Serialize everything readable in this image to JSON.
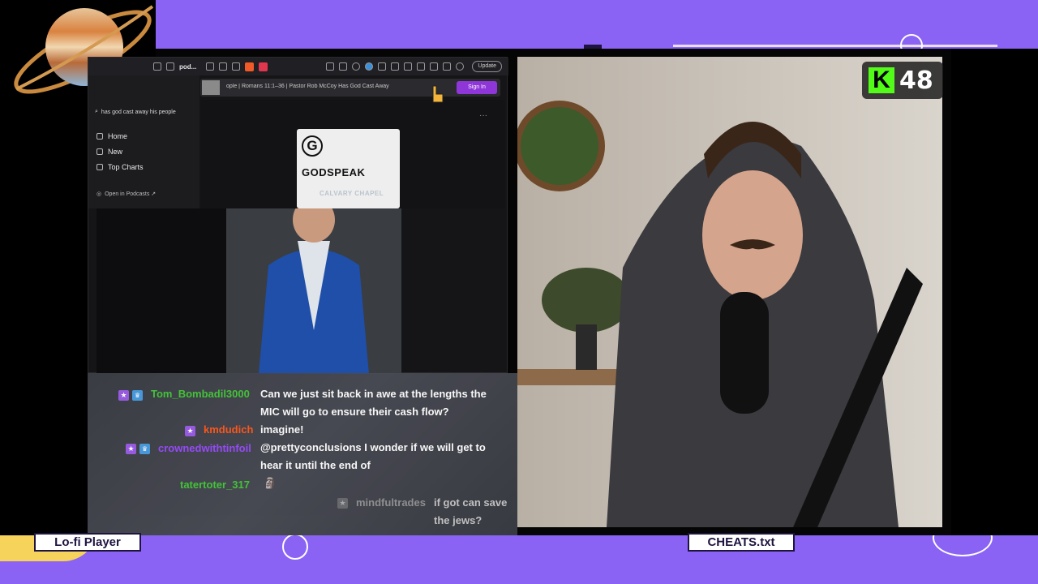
{
  "stream": {
    "viewer_count": "48",
    "label_left": "Lo-fi Player",
    "label_right": "CHEATS.txt"
  },
  "colors": {
    "background": "#7b5cf0",
    "kick_green": "#53fc18",
    "signin_purple": "#8f36d9"
  },
  "browser": {
    "tab_title": "pod...",
    "update_label": "Update",
    "search_value": "has god cast away his people",
    "nav": [
      "Home",
      "New",
      "Top Charts"
    ],
    "open_podcasts": "Open in Podcasts ↗",
    "now_playing": "ople | Romans 11:1–36 | Pastor Rob McCoy  Has God Cast Away",
    "signin_label": "Sign In",
    "podcast_card": {
      "letter": "G",
      "title": "GODSPEAK",
      "subtitle": "CALVARY CHAPEL"
    }
  },
  "chat": [
    {
      "user": "Tom_Bombadil3000",
      "color": "#45c93a",
      "badges": [
        "star",
        "sub"
      ],
      "line1": "Can we just sit back in awe at the lengths the",
      "line2": "MIC will go to ensure their cash flow?"
    },
    {
      "user": "kmdudich",
      "color": "#ff5a1f",
      "badges": [
        "star"
      ],
      "line1": "imagine!",
      "line2": ""
    },
    {
      "user": "crownedwithtinfoil",
      "color": "#9a4dff",
      "badges": [
        "star",
        "sub"
      ],
      "line1": "@prettyconclusions I wonder if we will get to",
      "line2": "hear it until the end of"
    },
    {
      "user": "tatertoter_317",
      "color": "#45c93a",
      "badges": [],
      "line1": "",
      "line2": ""
    },
    {
      "user": "mindfultrades",
      "color": "#a7a7a7",
      "badges": [
        "star"
      ],
      "line1": "if got can save",
      "line2": "the jews?"
    }
  ]
}
